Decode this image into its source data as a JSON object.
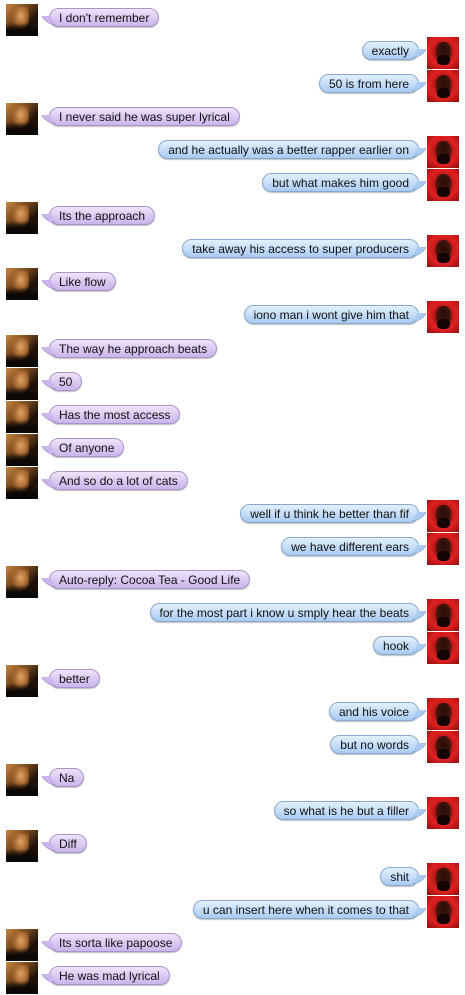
{
  "colors": {
    "incoming_bubble": "#dccaf2",
    "outgoing_bubble": "#c6def8",
    "background": "#ffffff"
  },
  "participants": {
    "left": {
      "avatar_icon": "hands-on-face-avatar-icon"
    },
    "right": {
      "avatar_icon": "bearded-man-red-avatar-icon"
    }
  },
  "messages": [
    {
      "side": "left",
      "text": "I don't remember"
    },
    {
      "side": "right",
      "text": "exactly"
    },
    {
      "side": "right",
      "text": "50 is from here"
    },
    {
      "side": "left",
      "text": "I never said he was super lyrical"
    },
    {
      "side": "right",
      "text": "and he actually was a better rapper earlier on"
    },
    {
      "side": "right",
      "text": "but what makes him good"
    },
    {
      "side": "left",
      "text": "Its the approach"
    },
    {
      "side": "right",
      "text": "take away his access to super producers"
    },
    {
      "side": "left",
      "text": "Like flow"
    },
    {
      "side": "right",
      "text": "iono man i wont give him that"
    },
    {
      "side": "left",
      "text": "The way he approach beats"
    },
    {
      "side": "left",
      "text": "50"
    },
    {
      "side": "left",
      "text": "Has the most access"
    },
    {
      "side": "left",
      "text": "Of anyone"
    },
    {
      "side": "left",
      "text": "And so do a lot of cats"
    },
    {
      "side": "right",
      "text": "well if u think he better than fif"
    },
    {
      "side": "right",
      "text": "we have different ears"
    },
    {
      "side": "left",
      "text": "Auto-reply: Cocoa Tea - Good Life"
    },
    {
      "side": "right",
      "text": "for the most part i know u smply hear the beats"
    },
    {
      "side": "right",
      "text": "hook"
    },
    {
      "side": "left",
      "text": "better"
    },
    {
      "side": "right",
      "text": "and his voice"
    },
    {
      "side": "right",
      "text": "but no words"
    },
    {
      "side": "left",
      "text": "Na"
    },
    {
      "side": "right",
      "text": "so what is he but a filler"
    },
    {
      "side": "left",
      "text": "Diff"
    },
    {
      "side": "right",
      "text": "shit"
    },
    {
      "side": "right",
      "text": "u can insert here when it comes to that"
    },
    {
      "side": "left",
      "text": "Its sorta like papoose"
    },
    {
      "side": "left",
      "text": "He was mad lyrical"
    }
  ]
}
